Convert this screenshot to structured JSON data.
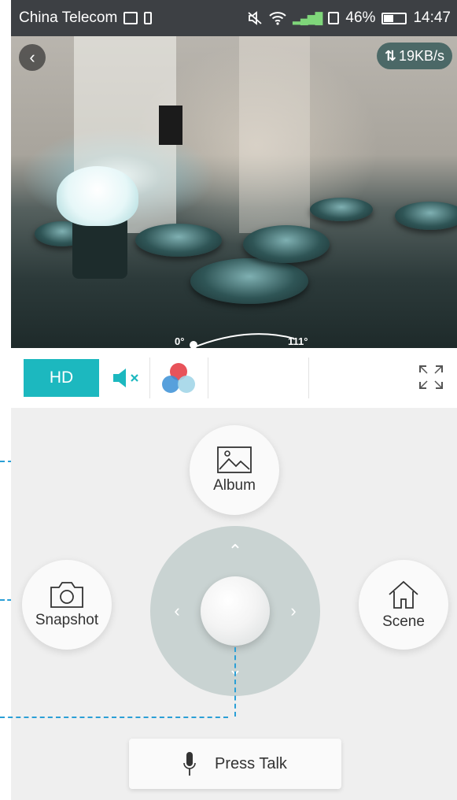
{
  "status_bar": {
    "carrier": "China Telecom",
    "battery_percent": "46%",
    "battery_level": 0.46,
    "time": "14:47"
  },
  "video": {
    "speed": "19KB/s",
    "pan_start": "0°",
    "pan_end": "111°"
  },
  "controls": {
    "quality_label": "HD"
  },
  "actions": {
    "album": "Album",
    "snapshot": "Snapshot",
    "scene": "Scene",
    "talk": "Press Talk"
  },
  "colors": {
    "accent": "#1cb8bf",
    "callout": "#2a9fd6"
  }
}
